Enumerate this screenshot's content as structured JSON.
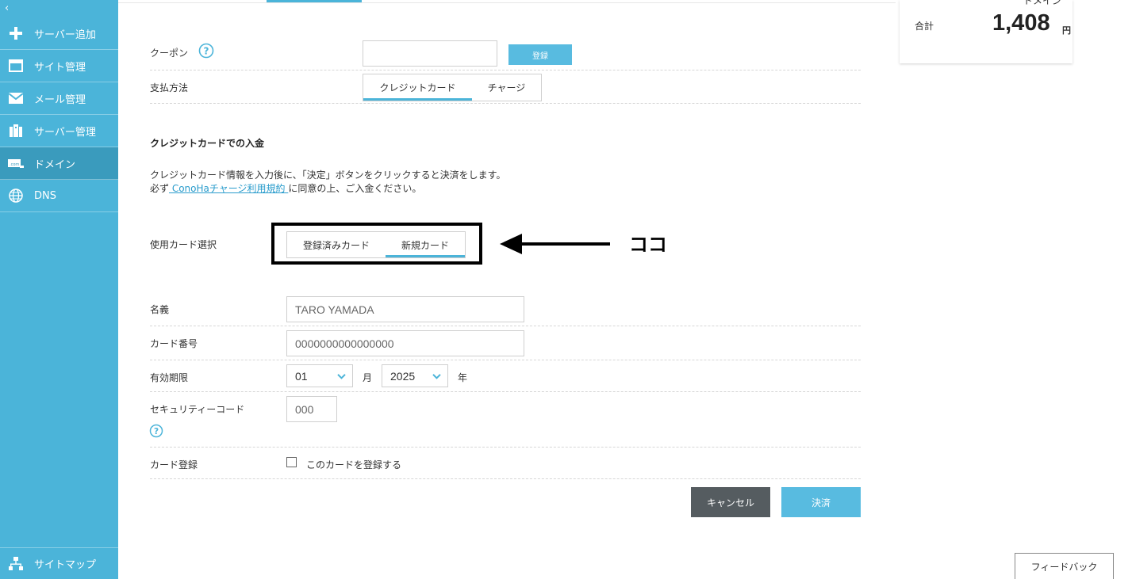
{
  "sidebar": {
    "collapse_glyph": "‹",
    "items": [
      {
        "label": "サーバー追加",
        "icon": "plus-icon"
      },
      {
        "label": "サイト管理",
        "icon": "window-icon"
      },
      {
        "label": "メール管理",
        "icon": "mail-icon"
      },
      {
        "label": "サーバー管理",
        "icon": "server-icon"
      },
      {
        "label": "ドメイン",
        "icon": "domain-icon",
        "active": true
      },
      {
        "label": "DNS",
        "icon": "globe-icon"
      }
    ],
    "sitemap_label": "サイトマップ"
  },
  "form": {
    "coupon_label": "クーポン",
    "coupon_value": "",
    "register_button": "登録",
    "payment_label": "支払方法",
    "payment_tabs": [
      "クレジットカード",
      "チャージ"
    ],
    "payment_selected": "クレジットカード",
    "section_heading": "クレジットカードでの入金",
    "desc_line1": "クレジットカード情報を入力後に、「決定」ボタンをクリックすると決済をします。",
    "desc_prefix": "必ず",
    "desc_link": " ConoHaチャージ利用規約 ",
    "desc_suffix": "に同意の上、ご入金ください。",
    "card_select_label": "使用カード選択",
    "card_tabs": [
      "登録済みカード",
      "新規カード"
    ],
    "card_selected": "新規カード",
    "name_label": "名義",
    "name_placeholder": "TARO YAMADA",
    "card_number_label": "カード番号",
    "card_number_placeholder": "0000000000000000",
    "expiry_label": "有効期限",
    "expiry_month": "01",
    "month_unit": "月",
    "expiry_year": "2025",
    "year_unit": "年",
    "security_label": "セキュリティーコード",
    "security_placeholder": "000",
    "card_register_label": "カード登録",
    "card_register_checkbox": "このカードを登録する",
    "cancel_button": "キャンセル",
    "pay_button": "決済"
  },
  "annotation": {
    "text": "ココ"
  },
  "summary": {
    "top_text": "ドメイン",
    "total_label": "合計",
    "total_amount": "1,408",
    "unit": "円"
  },
  "feedback_button": "フィードバック",
  "colors": {
    "accent": "#4bb4d9",
    "active_item": "#3a9bbd",
    "button_blue": "#58bbe0",
    "button_gray": "#555c60",
    "link": "#2a9ccc"
  }
}
